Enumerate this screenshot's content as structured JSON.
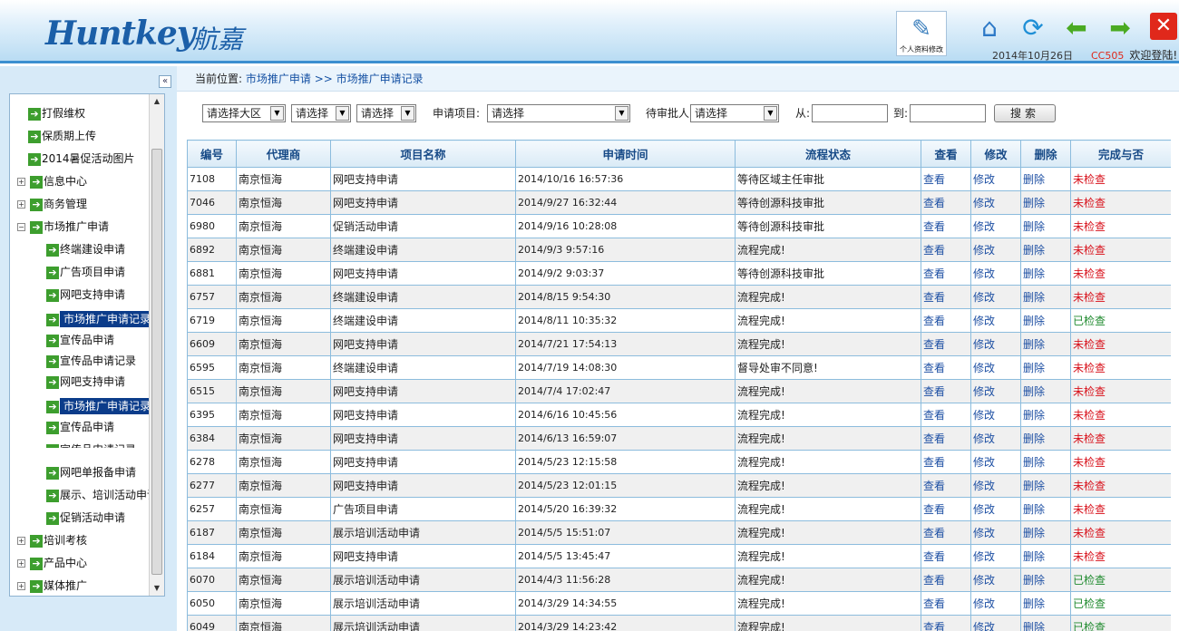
{
  "header": {
    "logo_en": "Huntkey",
    "logo_cn": "航嘉",
    "profile_label": "个人资料修改",
    "date": "2014年10月26日",
    "user": "CC505",
    "welcome": "欢迎登陆!"
  },
  "sidebar": {
    "collapse": "«",
    "items": [
      {
        "label": "打假维权"
      },
      {
        "label": "保质期上传"
      },
      {
        "label": "2014暑促活动图片"
      },
      {
        "label": "信息中心",
        "expander": "+"
      },
      {
        "label": "商务管理",
        "expander": "+"
      },
      {
        "label": "市场推广申请",
        "expander": "−"
      },
      {
        "label": "终端建设申请"
      },
      {
        "label": "广告项目申请"
      },
      {
        "label": "网吧支持申请"
      },
      {
        "label": "市场推广申请记录"
      },
      {
        "label": "宣传品申请"
      },
      {
        "label": "宣传品申请记录"
      },
      {
        "label": "网吧支持申请"
      },
      {
        "label": "市场推广申请记录"
      },
      {
        "label": "宣传品申请"
      },
      {
        "label": "宣传品申请记录"
      },
      {
        "label": "网吧单报备申请"
      },
      {
        "label": "展示、培训活动申请"
      },
      {
        "label": "促销活动申请"
      },
      {
        "label": "培训考核",
        "expander": "+"
      },
      {
        "label": "产品中心",
        "expander": "+"
      },
      {
        "label": "媒体推广",
        "expander": "+"
      }
    ]
  },
  "breadcrumb": {
    "prefix": "当前位置:",
    "level1": "市场推广申请",
    "separator": ">>",
    "level2": "市场推广申请记录"
  },
  "filters": {
    "region": "请选择大区",
    "select2": "请选择",
    "select3": "请选择",
    "project_label": "申请项目:",
    "project": "请选择",
    "approver_label": "待审批人",
    "approver": "请选择",
    "from_label": "从:",
    "to_label": "到:",
    "search": "搜索"
  },
  "table": {
    "headers": [
      "编号",
      "代理商",
      "项目名称",
      "申请时间",
      "流程状态",
      "查看",
      "修改",
      "删除",
      "完成与否"
    ],
    "view_label": "查看",
    "edit_label": "修改",
    "delete_label": "删除",
    "rows": [
      {
        "id": "7108",
        "agent": "南京恒海",
        "project": "网吧支持申请",
        "time": "2014/10/16 16:57:36",
        "status": "等待区域主任审批",
        "done": "未检查"
      },
      {
        "id": "7046",
        "agent": "南京恒海",
        "project": "网吧支持申请",
        "time": "2014/9/27 16:32:44",
        "status": "等待创源科技审批",
        "done": "未检查"
      },
      {
        "id": "6980",
        "agent": "南京恒海",
        "project": "促销活动申请",
        "time": "2014/9/16 10:28:08",
        "status": "等待创源科技审批",
        "done": "未检查"
      },
      {
        "id": "6892",
        "agent": "南京恒海",
        "project": "终端建设申请",
        "time": "2014/9/3 9:57:16",
        "status": "流程完成!",
        "done": "未检查"
      },
      {
        "id": "6881",
        "agent": "南京恒海",
        "project": "网吧支持申请",
        "time": "2014/9/2 9:03:37",
        "status": "等待创源科技审批",
        "done": "未检查"
      },
      {
        "id": "6757",
        "agent": "南京恒海",
        "project": "终端建设申请",
        "time": "2014/8/15 9:54:30",
        "status": "流程完成!",
        "done": "未检查"
      },
      {
        "id": "6719",
        "agent": "南京恒海",
        "project": "终端建设申请",
        "time": "2014/8/11 10:35:32",
        "status": "流程完成!",
        "done": "已检查"
      },
      {
        "id": "6609",
        "agent": "南京恒海",
        "project": "网吧支持申请",
        "time": "2014/7/21 17:54:13",
        "status": "流程完成!",
        "done": "未检查"
      },
      {
        "id": "6595",
        "agent": "南京恒海",
        "project": "终端建设申请",
        "time": "2014/7/19 14:08:30",
        "status": "督导处审不同意!",
        "done": "未检查"
      },
      {
        "id": "6515",
        "agent": "南京恒海",
        "project": "网吧支持申请",
        "time": "2014/7/4 17:02:47",
        "status": "流程完成!",
        "done": "未检查"
      },
      {
        "id": "6395",
        "agent": "南京恒海",
        "project": "网吧支持申请",
        "time": "2014/6/16 10:45:56",
        "status": "流程完成!",
        "done": "未检查"
      },
      {
        "id": "6384",
        "agent": "南京恒海",
        "project": "网吧支持申请",
        "time": "2014/6/13 16:59:07",
        "status": "流程完成!",
        "done": "未检查"
      },
      {
        "id": "6278",
        "agent": "南京恒海",
        "project": "网吧支持申请",
        "time": "2014/5/23 12:15:58",
        "status": "流程完成!",
        "done": "未检查"
      },
      {
        "id": "6277",
        "agent": "南京恒海",
        "project": "网吧支持申请",
        "time": "2014/5/23 12:01:15",
        "status": "流程完成!",
        "done": "未检查"
      },
      {
        "id": "6257",
        "agent": "南京恒海",
        "project": "广告项目申请",
        "time": "2014/5/20 16:39:32",
        "status": "流程完成!",
        "done": "未检查"
      },
      {
        "id": "6187",
        "agent": "南京恒海",
        "project": "展示培训活动申请",
        "time": "2014/5/5 15:51:07",
        "status": "流程完成!",
        "done": "未检查"
      },
      {
        "id": "6184",
        "agent": "南京恒海",
        "project": "网吧支持申请",
        "time": "2014/5/5 13:45:47",
        "status": "流程完成!",
        "done": "未检查"
      },
      {
        "id": "6070",
        "agent": "南京恒海",
        "project": "展示培训活动申请",
        "time": "2014/4/3 11:56:28",
        "status": "流程完成!",
        "done": "已检查"
      },
      {
        "id": "6050",
        "agent": "南京恒海",
        "project": "展示培训活动申请",
        "time": "2014/3/29 14:34:55",
        "status": "流程完成!",
        "done": "已检查"
      },
      {
        "id": "6049",
        "agent": "南京恒海",
        "project": "展示培训活动申请",
        "time": "2014/3/29 14:23:42",
        "status": "流程完成!",
        "done": "已检查"
      }
    ]
  }
}
